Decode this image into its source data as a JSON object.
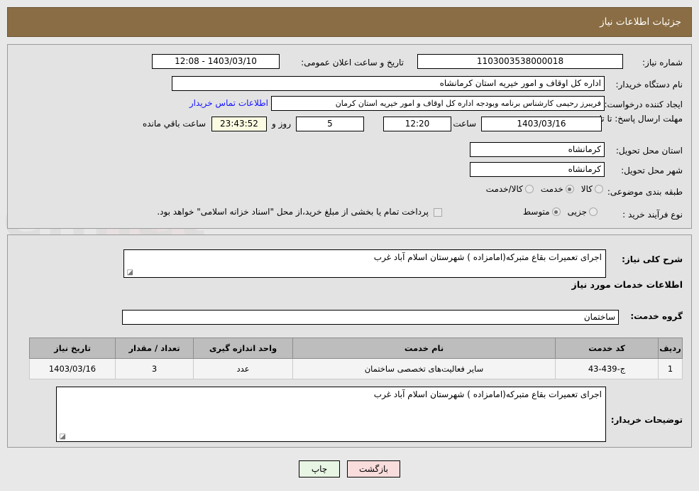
{
  "header": {
    "title": "جزئیات اطلاعات نیاز",
    "bg_color": "#8a6d44",
    "text_color": "#ffffff"
  },
  "form": {
    "need_number_label": "شماره نیاز:",
    "need_number_value": "1103003538000018",
    "announce_datetime_label": "تاریخ و ساعت اعلان عمومی:",
    "announce_datetime_value": "1403/03/10 - 12:08",
    "buyer_org_label": "نام دستگاه خریدار:",
    "buyer_org_value": "اداره کل اوقاف و امور خیریه استان کرمانشاه",
    "requester_label": "ایجاد کننده درخواست:",
    "requester_value": "فریبرز رحیمی کارشناس برنامه وبودجه اداره کل اوقاف و امور خیریه استان کرمان",
    "contact_link": "اطلاعات تماس خریدار",
    "deadline_label": "مهلت ارسال پاسخ: تا تاریخ:",
    "deadline_date": "1403/03/16",
    "deadline_hour_label": "ساعت",
    "deadline_hour_value": "12:20",
    "remaining_days": "5",
    "remaining_days_label": "روز و",
    "remaining_time": "23:43:52",
    "remaining_suffix": "ساعت باقي مانده",
    "province_label": "استان محل تحویل:",
    "province_value": "کرمانشاه",
    "city_label": "شهر محل تحویل:",
    "city_value": "کرمانشاه",
    "category_label": "طبقه بندی موضوعی:",
    "category_options": [
      {
        "label": "کالا",
        "selected": false
      },
      {
        "label": "خدمت",
        "selected": true
      },
      {
        "label": "کالا/خدمت",
        "selected": false
      }
    ],
    "process_label": "نوع فرآیند خرید :",
    "process_options": [
      {
        "label": "جزیی",
        "selected": false
      },
      {
        "label": "متوسط",
        "selected": true
      }
    ],
    "treasury_checkbox_checked": false,
    "treasury_note": "پرداخت تمام یا بخشی از مبلغ خرید،از محل \"اسناد خزانه اسلامی\" خواهد بود."
  },
  "body": {
    "general_desc_label": "شرح کلی نیاز:",
    "general_desc_value": "اجرای تعمیرات بقاع متبرکه(امامزاده ) شهرستان اسلام آباد غرب",
    "services_section_title": "اطلاعات خدمات مورد نیاز",
    "service_group_label": "گروه خدمت:",
    "service_group_value": "ساختمان",
    "buyer_notes_label": "توضیحات خریدار:",
    "buyer_notes_value": "اجرای تعمیرات بقاع متبرکه(امامزاده ) شهرستان اسلام آباد غرب"
  },
  "table": {
    "headers": [
      "ردیف",
      "کد خدمت",
      "نام خدمت",
      "واحد اندازه گیری",
      "تعداد / مقدار",
      "تاریخ نیاز"
    ],
    "rows": [
      {
        "index": "1",
        "code": "ج-439-43",
        "name": "سایر فعالیت‌های تخصصی ساختمان",
        "unit": "عدد",
        "quantity": "3",
        "date": "1403/03/16"
      }
    ]
  },
  "buttons": {
    "print": "چاپ",
    "back": "بازگشت"
  },
  "watermark": {
    "text": "AriaTender.net"
  }
}
